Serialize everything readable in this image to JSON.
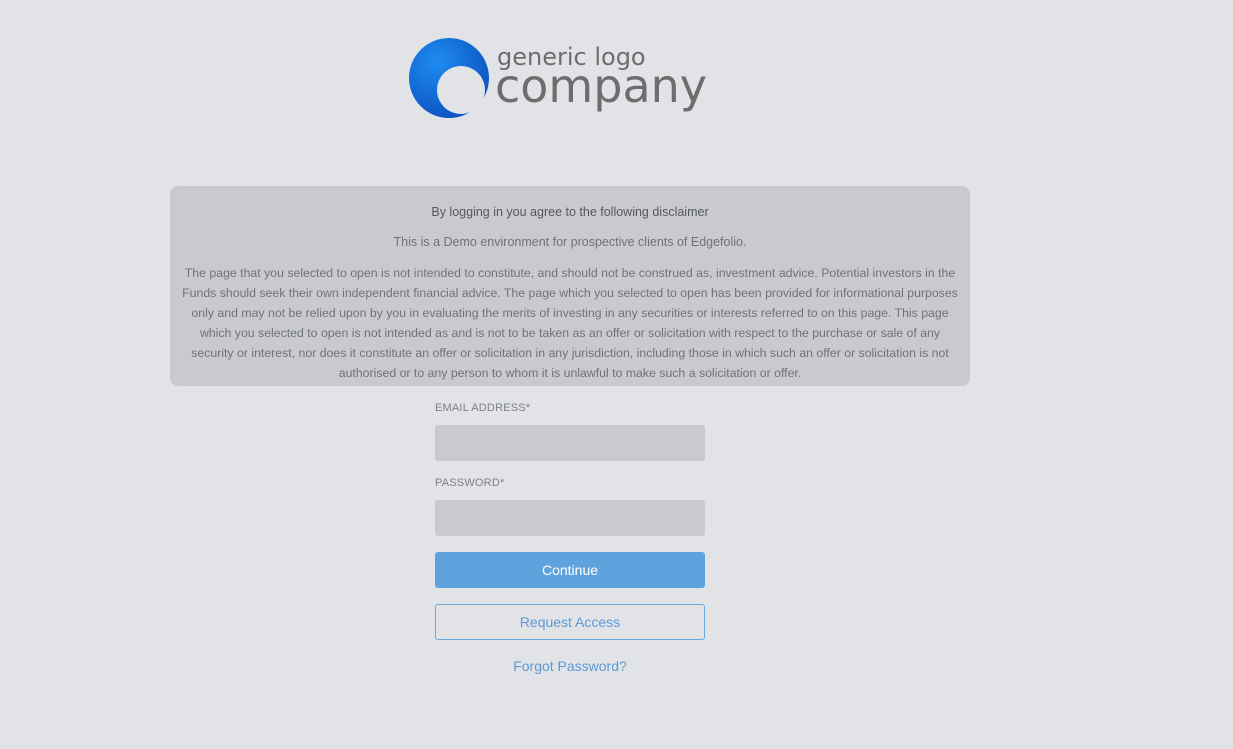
{
  "logo": {
    "line1": "generic logo",
    "line2": "company",
    "icon": "logo-circle-icon",
    "colors": {
      "mark_dark": "#0a52bf",
      "mark_light": "#1e8cf0",
      "text": "#6d6d6d"
    }
  },
  "disclaimer": {
    "heading": "By logging in you agree to the following disclaimer",
    "intro": "This is a Demo environment for prospective clients of Edgefolio.",
    "body": "The page that you selected to open is not intended to constitute, and should not be construed as, investment advice. Potential investors in the Funds should seek their own independent financial advice. The page which you selected to open has been provided for informational purposes only and may not be relied upon by you in evaluating the merits of investing in any securities or interests referred to on this page. This page which you selected to open is not intended as and is not to be taken as an offer or solicitation with respect to the purchase or sale of any security or interest, nor does it constitute an offer or solicitation in any jurisdiction, including those in which such an offer or solicitation is not authorised or to any person to whom it is unlawful to make such a solicitation or offer."
  },
  "form": {
    "email_label": "EMAIL ADDRESS*",
    "email_value": "",
    "password_label": "PASSWORD*",
    "password_value": "",
    "continue_label": "Continue",
    "request_access_label": "Request Access",
    "forgot_password_label": "Forgot Password?"
  },
  "colors": {
    "background": "#e1e3e7",
    "panel": "#c9cacd",
    "accent": "#5fa3de",
    "link": "#5b9ad6"
  }
}
